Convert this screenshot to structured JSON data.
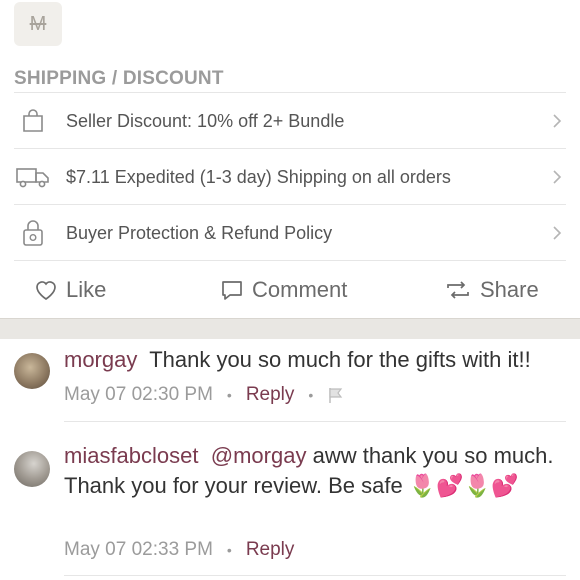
{
  "header": {
    "avatar_letter": "M"
  },
  "section": {
    "title": "SHIPPING / DISCOUNT"
  },
  "rows": [
    {
      "icon": "bag-icon",
      "label": "Seller Discount: 10% off 2+ Bundle"
    },
    {
      "icon": "truck-icon",
      "label": "$7.11 Expedited (1-3 day) Shipping on all orders"
    },
    {
      "icon": "lock-icon",
      "label": "Buyer Protection & Refund Policy"
    }
  ],
  "actions": {
    "like": "Like",
    "comment": "Comment",
    "share": "Share"
  },
  "comments": [
    {
      "user": "morgay",
      "text": "Thank you so much for the gifts with it!!",
      "timestamp": "May 07 02:30 PM",
      "reply_label": "Reply"
    },
    {
      "user": "miasfabcloset",
      "mention": "@morgay",
      "text": "aww thank you so much. Thank you for your review. Be safe 🌷💕🌷💕",
      "timestamp": "May 07 02:33 PM",
      "reply_label": "Reply"
    }
  ],
  "colors": {
    "accent": "#7a3b4f",
    "muted": "#9b9b9b",
    "band": "#e9e7e3"
  }
}
